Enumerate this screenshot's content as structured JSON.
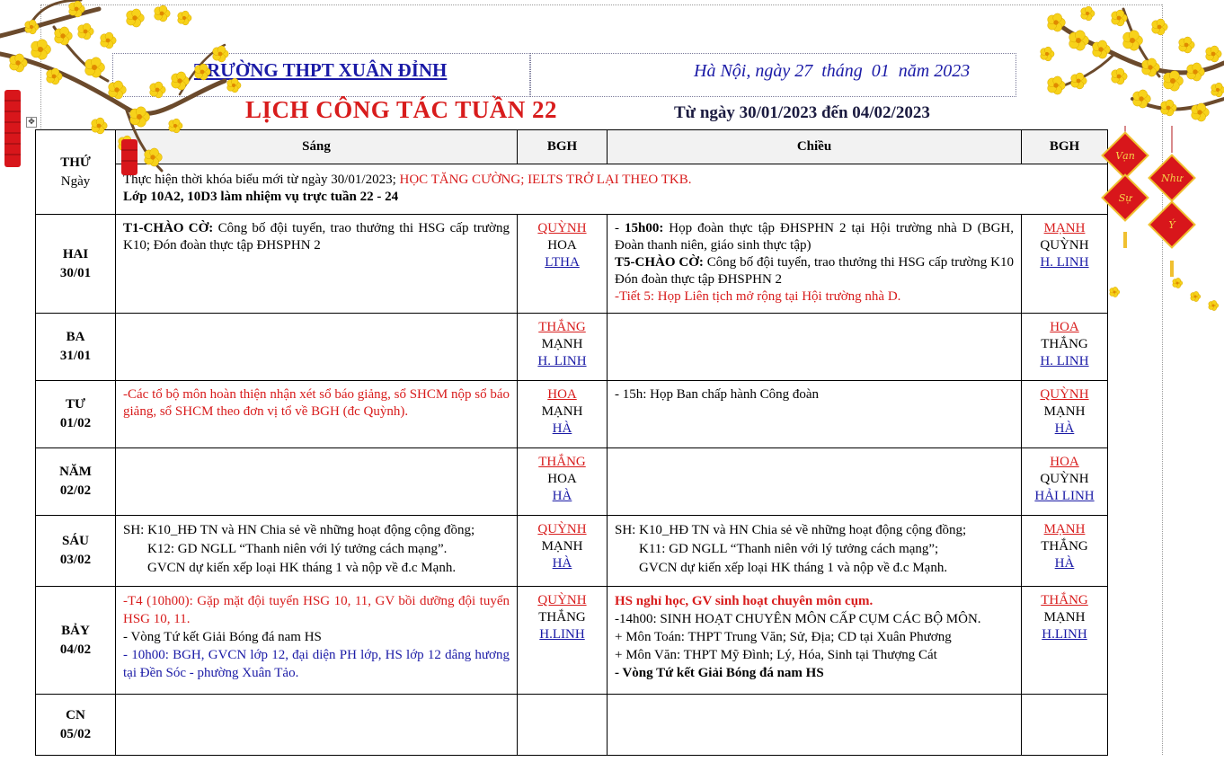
{
  "header": {
    "school": "TRƯỜNG THPT XUÂN ĐỈNH",
    "date_line": "Hà Nội, ngày 27  tháng  01  năm 2023",
    "title": "LỊCH CÔNG TÁC TUẦN 22",
    "range": "Từ ngày 30/01/2023 đến 04/02/2023"
  },
  "table": {
    "col_day": "THỨ",
    "col_day_sub": "Ngày",
    "col_morning": "Sáng",
    "col_bgh1": "BGH",
    "col_afternoon": "Chiều",
    "col_bgh2": "BGH",
    "general": {
      "part1": "Thực hiện thời khóa biểu mới từ ngày 30/01/2023; ",
      "part2": "HỌC TĂNG CƯỜNG; IELTS TRỞ LẠI THEO TKB.",
      "line2": "Lớp 10A2, 10D3 làm nhiệm vụ trực tuần 22 - 24"
    },
    "rows": [
      {
        "day": "HAI",
        "date": "30/01",
        "morning_bold": "T1-CHÀO CỜ:",
        "morning_text": " Công bố đội tuyển, trao thưởng thi HSG cấp trường K10; Đón đoàn thực tập ĐHSPHN 2",
        "bgh_am": [
          "QUỲNH",
          "HOA",
          "LTHA"
        ],
        "pm_l1_bold": "15h00:",
        "pm_l1_pre": "- ",
        "pm_l1_text": " Họp đoàn thực tập ĐHSPHN 2 tại Hội trường nhà D (BGH, Đoàn thanh niên, giáo sinh thực tập)",
        "pm_l2_bold": "T5-CHÀO CỜ:",
        "pm_l2_text": " Công bố đội tuyển, trao thưởng thi HSG cấp trường K10 Đón đoàn thực tập ĐHSPHN 2",
        "pm_l3": "-Tiết 5: Họp Liên tịch mở rộng tại Hội trường nhà D.",
        "bgh_pm": [
          "MẠNH",
          "QUỲNH",
          "H. LINH"
        ]
      },
      {
        "day": "BA",
        "date": "31/01",
        "bgh_am": [
          "THẮNG",
          "MẠNH",
          "H. LINH"
        ],
        "bgh_pm": [
          "HOA",
          "THẮNG",
          "H. LINH"
        ]
      },
      {
        "day": "TƯ",
        "date": "01/02",
        "morning": "-Các tổ bộ môn hoàn thiện nhận xét sổ báo giảng, sổ SHCM nộp sổ báo giảng, sổ SHCM theo đơn vị tổ về BGH (đc Quỳnh).",
        "afternoon": "- 15h: Họp Ban chấp hành Công đoàn",
        "bgh_am": [
          "HOA",
          "MẠNH",
          "HÀ"
        ],
        "bgh_pm": [
          "QUỲNH",
          "MẠNH",
          "HÀ"
        ]
      },
      {
        "day": "NĂM",
        "date": "02/02",
        "bgh_am": [
          "THẮNG",
          "HOA",
          "HÀ"
        ],
        "bgh_pm": [
          "HOA",
          "QUỲNH",
          "HẢI LINH"
        ]
      },
      {
        "day": "SÁU",
        "date": "03/02",
        "morning": [
          "SH: K10_HĐ TN và HN Chia sẻ về những hoạt động cộng đồng;",
          "K12: GD NGLL “Thanh niên với lý tưởng cách mạng”.",
          "GVCN dự kiến xếp loại HK tháng 1 và nộp về đ.c Mạnh."
        ],
        "afternoon": [
          "SH: K10_HĐ TN và HN Chia sẻ về những hoạt động cộng đồng;",
          "K11: GD NGLL “Thanh niên với lý tưởng cách mạng”;",
          "GVCN dự kiến xếp loại HK tháng 1 và nộp về đ.c Mạnh."
        ],
        "bgh_am": [
          "QUỲNH",
          "MẠNH",
          "HÀ"
        ],
        "bgh_pm": [
          "MẠNH",
          "THẮNG",
          "HÀ"
        ]
      },
      {
        "day": "BẢY",
        "date": "04/02",
        "morning_red": "-T4 (10h00): Gặp mặt đội tuyển HSG 10, 11, GV bồi dưỡng đội tuyển HSG 10, 11.",
        "morning_black": "- Vòng Tứ kết Giải Bóng đá nam HS",
        "morning_blue": "- 10h00: BGH, GVCN lớp 12, đại diện PH lớp, HS lớp 12 dâng hương tại Đền Sóc - phường Xuân Tảo.",
        "pm_red": "HS nghỉ học, GV sinh hoạt chuyên môn cụm.",
        "pm_lines": [
          "-14h00: SINH HOẠT CHUYÊN MÔN CẤP CỤM CÁC BỘ MÔN.",
          "+ Môn Toán: THPT Trung Văn; Sử, Địa; CD tại Xuân Phương",
          "+ Môn Văn: THPT Mỹ Đình; Lý, Hóa, Sinh tại Thượng Cát"
        ],
        "pm_bold": "- Vòng Tứ kết Giải Bóng đá nam HS",
        "bgh_am": [
          "QUỲNH",
          "THẮNG",
          "H.LINH"
        ],
        "bgh_pm": [
          "THẮNG",
          "MẠNH",
          "H.LINH"
        ]
      },
      {
        "day": "CN",
        "date": "05/02"
      }
    ]
  },
  "decor": {
    "blossom_color": "#f7d21a",
    "blossom_center": "#e08a00",
    "branch_color": "#6b4a2c",
    "lantern_color": "#d8161b",
    "lantern_text": [
      "Vạn",
      "Sự",
      "Như",
      "Ý"
    ]
  }
}
